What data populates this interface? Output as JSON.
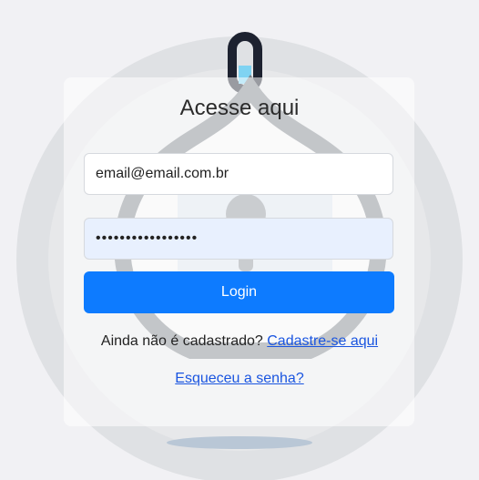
{
  "login": {
    "title": "Acesse aqui",
    "email_value": "email@email.com.br",
    "password_value": "•••••••••••••••••",
    "login_label": "Login",
    "signup_prompt": "Ainda não é cadastrado? ",
    "signup_link": "Cadastre-se aqui",
    "forgot_link": "Esqueceu a senha?"
  },
  "colors": {
    "accent": "#0d7bff",
    "link": "#1a55e0",
    "password_bg": "#e8f0fe",
    "background": "#f1f1f4"
  },
  "icons": [
    "padlock-background-illustration"
  ]
}
